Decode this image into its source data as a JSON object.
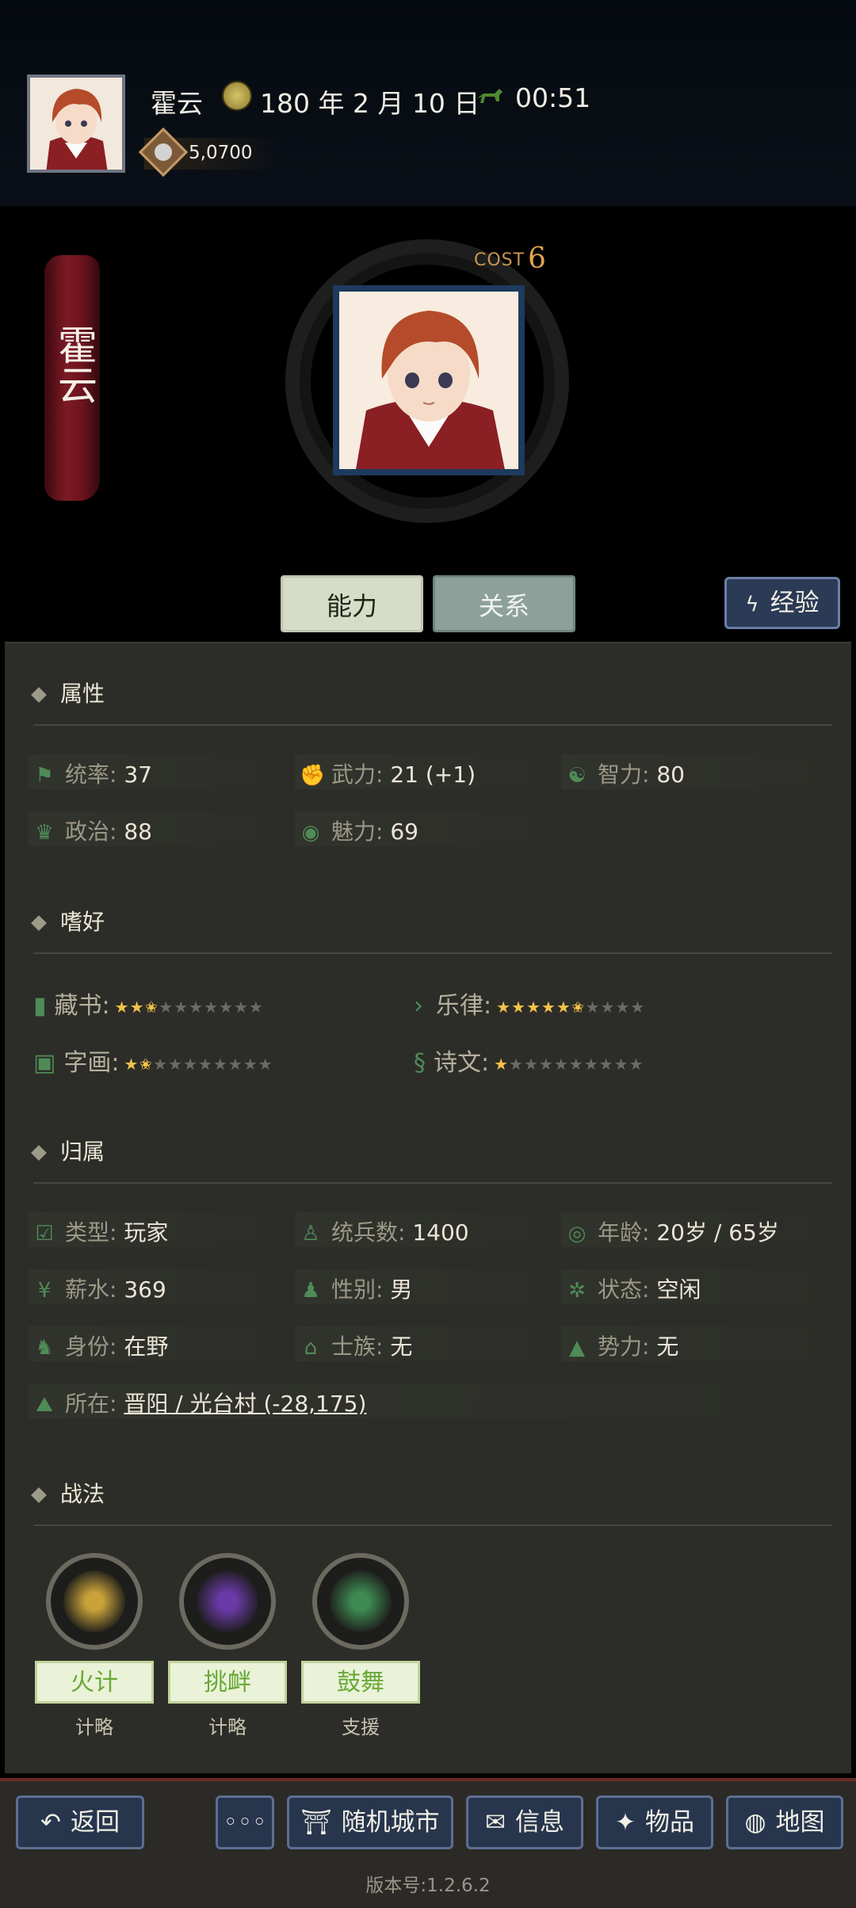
{
  "header": {
    "player_name": "霍云",
    "date": "180 年 2 月 10 日",
    "time": "00:51",
    "coins": "5,0700"
  },
  "character": {
    "name": "霍云",
    "cost_label": "COST",
    "cost_value": "6"
  },
  "tabs": {
    "ability": "能力",
    "relation": "关系",
    "exp": "经验"
  },
  "sections": {
    "attributes": "属性",
    "hobbies": "嗜好",
    "affiliation": "归属",
    "tactics": "战法"
  },
  "attributes": [
    {
      "label": "统率:",
      "value": "37",
      "icon": "flag-icon"
    },
    {
      "label": "武力:",
      "value": "21 (+1)",
      "icon": "arm-icon"
    },
    {
      "label": "智力:",
      "value": "80",
      "icon": "brain-icon"
    },
    {
      "label": "政治:",
      "value": "88",
      "icon": "hat-icon"
    },
    {
      "label": "魅力:",
      "value": "69",
      "icon": "eye-icon"
    }
  ],
  "hobbies": [
    {
      "label": "藏书:",
      "stars": 2.5,
      "max": 10,
      "icon": "book-icon"
    },
    {
      "label": "乐律:",
      "stars": 5.5,
      "max": 10,
      "icon": "music-icon"
    },
    {
      "label": "字画:",
      "stars": 1.5,
      "max": 10,
      "icon": "scroll-icon"
    },
    {
      "label": "诗文:",
      "stars": 1,
      "max": 10,
      "icon": "poem-icon"
    }
  ],
  "affiliation": {
    "type_label": "类型:",
    "type_value": "玩家",
    "troops_label": "统兵数:",
    "troops_value": "1400",
    "age_label": "年龄:",
    "age_value": "20岁 / 65岁",
    "salary_label": "薪水:",
    "salary_value": "369",
    "gender_label": "性别:",
    "gender_value": "男",
    "status_label": "状态:",
    "status_value": "空闲",
    "identity_label": "身份:",
    "identity_value": "在野",
    "clan_label": "士族:",
    "clan_value": "无",
    "faction_label": "势力:",
    "faction_value": "无",
    "location_label": "所在:",
    "location_value": "晋阳 / 光台村 (-28,175)"
  },
  "tactics": [
    {
      "name": "火计",
      "type": "计略",
      "color": "#c9a23a"
    },
    {
      "name": "挑衅",
      "type": "计略",
      "color": "#6a3aa8"
    },
    {
      "name": "鼓舞",
      "type": "支援",
      "color": "#3e8a52"
    }
  ],
  "bottom_bar": {
    "back": "返回",
    "more": "◦◦◦",
    "random_city": "随机城市",
    "info": "信息",
    "items": "物品",
    "map": "地图",
    "version": "版本号:1.2.6.2"
  },
  "colors": {
    "accent_green": "#6aa93a",
    "link_green": "#6bb34a",
    "star_gold": "#f3c24a",
    "banner_red": "#7c1a24"
  }
}
